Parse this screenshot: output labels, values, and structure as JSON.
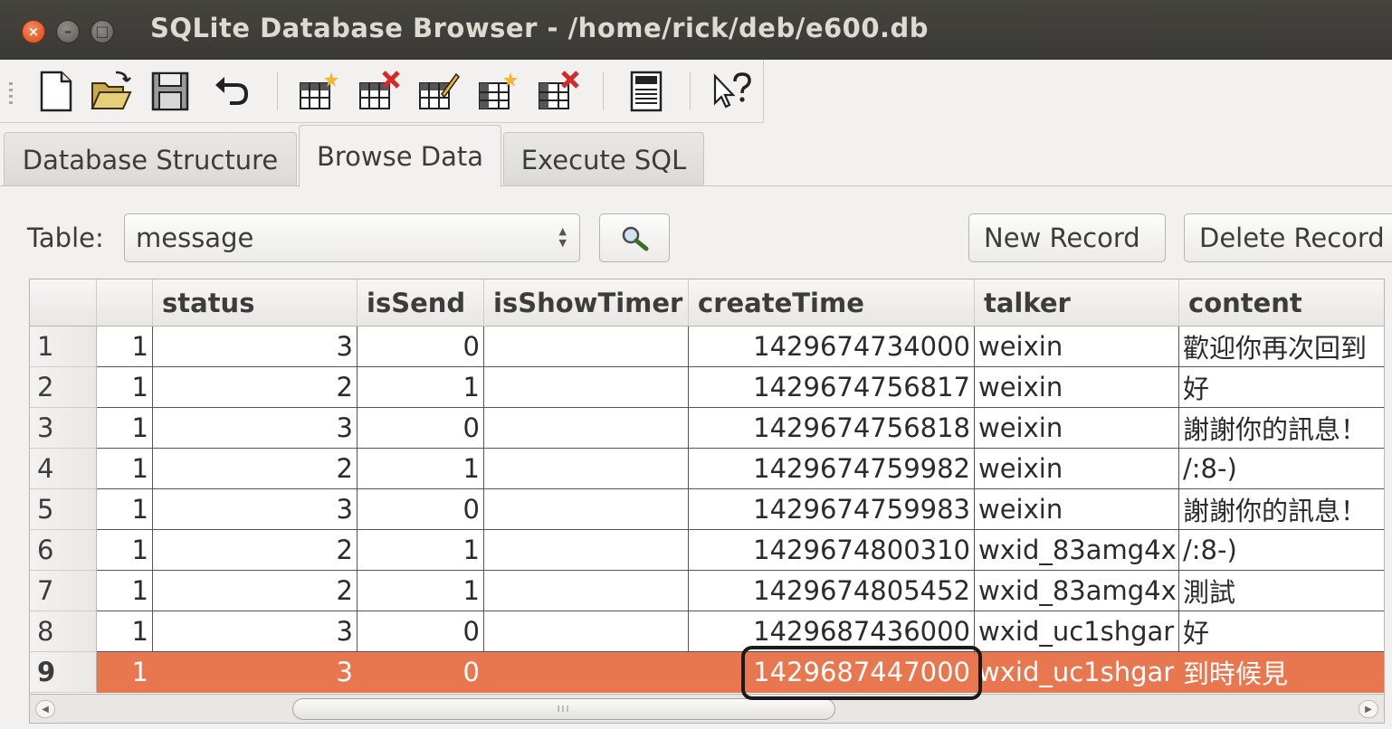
{
  "window": {
    "title": "SQLite Database Browser - /home/rick/deb/e600.db",
    "close_glyph": "×",
    "min_glyph": "–",
    "max_glyph": "□"
  },
  "toolbar": {
    "icons": [
      "new-file-icon",
      "open-folder-icon",
      "save-icon",
      "undo-icon",
      "create-table-icon",
      "delete-table-icon",
      "modify-table-icon",
      "create-index-icon",
      "delete-index-icon",
      "log-icon",
      "whats-this-icon"
    ]
  },
  "tabs": [
    {
      "label": "Database Structure",
      "active": false
    },
    {
      "label": "Browse Data",
      "active": true
    },
    {
      "label": "Execute SQL",
      "active": false
    }
  ],
  "browse": {
    "table_label": "Table:",
    "table_value": "message",
    "new_record_label": "New Record",
    "delete_record_label": "Delete Record"
  },
  "grid": {
    "columns": [
      "",
      "status",
      "isSend",
      "isShowTimer",
      "createTime",
      "talker",
      "content"
    ],
    "rows": [
      {
        "num": "1",
        "c0": "1",
        "status": "3",
        "isSend": "0",
        "isShowTimer": "",
        "createTime": "1429674734000",
        "talker": "weixin",
        "content": "歡迎你再次回到"
      },
      {
        "num": "2",
        "c0": "1",
        "status": "2",
        "isSend": "1",
        "isShowTimer": "",
        "createTime": "1429674756817",
        "talker": "weixin",
        "content": "好"
      },
      {
        "num": "3",
        "c0": "1",
        "status": "3",
        "isSend": "0",
        "isShowTimer": "",
        "createTime": "1429674756818",
        "talker": "weixin",
        "content": "謝謝你的訊息！"
      },
      {
        "num": "4",
        "c0": "1",
        "status": "2",
        "isSend": "1",
        "isShowTimer": "",
        "createTime": "1429674759982",
        "talker": "weixin",
        "content": "/:8-)"
      },
      {
        "num": "5",
        "c0": "1",
        "status": "3",
        "isSend": "0",
        "isShowTimer": "",
        "createTime": "1429674759983",
        "talker": "weixin",
        "content": "謝謝你的訊息！"
      },
      {
        "num": "6",
        "c0": "1",
        "status": "2",
        "isSend": "1",
        "isShowTimer": "",
        "createTime": "1429674800310",
        "talker": "wxid_83amg4x",
        "content": "/:8-)"
      },
      {
        "num": "7",
        "c0": "1",
        "status": "2",
        "isSend": "1",
        "isShowTimer": "",
        "createTime": "1429674805452",
        "talker": "wxid_83amg4x",
        "content": "測試"
      },
      {
        "num": "8",
        "c0": "1",
        "status": "3",
        "isSend": "0",
        "isShowTimer": "",
        "createTime": "1429687436000",
        "talker": "wxid_uc1shgar",
        "content": "好"
      },
      {
        "num": "9",
        "c0": "1",
        "status": "3",
        "isSend": "0",
        "isShowTimer": "",
        "createTime": "1429687447000",
        "talker": "wxid_uc1shgar",
        "content": "到時候見",
        "selected": true
      }
    ]
  },
  "scrollbar": {
    "left_arrow": "◀",
    "right_arrow": "▶",
    "thumb_grip": "III"
  },
  "colors": {
    "selection": "#e8764f",
    "titlebar": "#3c3b37",
    "close_button": "#dd4814"
  }
}
